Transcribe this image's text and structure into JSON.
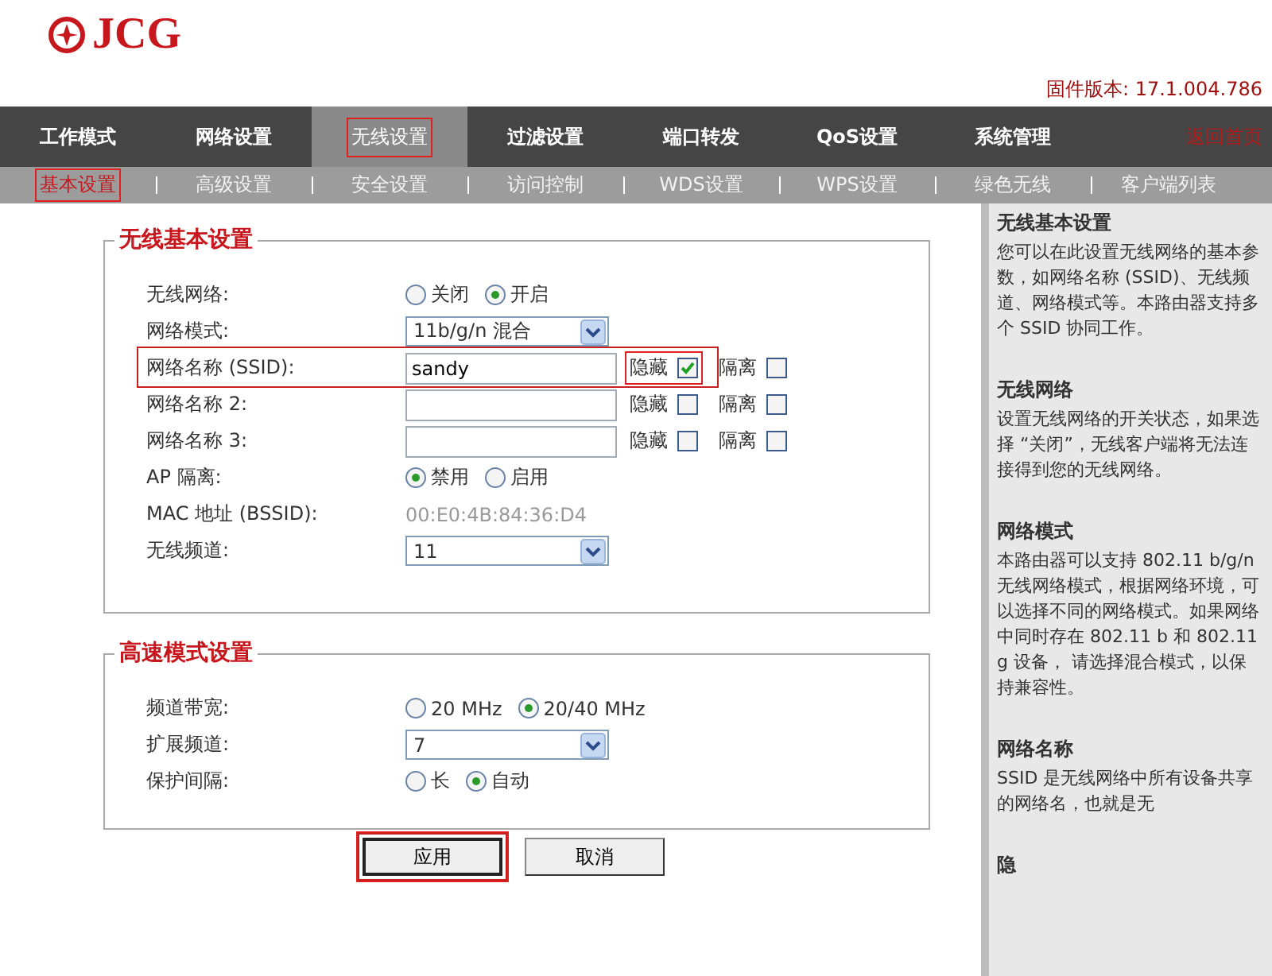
{
  "logo": {
    "text": "JCG"
  },
  "firmware": "固件版本: 17.1.004.786",
  "nav": [
    {
      "label": "工作模式",
      "selected": false,
      "highlighted": false
    },
    {
      "label": "网络设置",
      "selected": false,
      "highlighted": false
    },
    {
      "label": "无线设置",
      "selected": true,
      "highlighted": true
    },
    {
      "label": "过滤设置",
      "selected": false,
      "highlighted": false
    },
    {
      "label": "端口转发",
      "selected": false,
      "highlighted": false
    },
    {
      "label": "QoS设置",
      "selected": false,
      "highlighted": false
    },
    {
      "label": "系统管理",
      "selected": false,
      "highlighted": false
    }
  ],
  "home_link": "返回首页",
  "subnav": [
    {
      "label": "基本设置",
      "selected": true,
      "highlighted": true
    },
    {
      "label": "高级设置",
      "selected": false,
      "highlighted": false
    },
    {
      "label": "安全设置",
      "selected": false,
      "highlighted": false
    },
    {
      "label": "访问控制",
      "selected": false,
      "highlighted": false
    },
    {
      "label": "WDS设置",
      "selected": false,
      "highlighted": false
    },
    {
      "label": "WPS设置",
      "selected": false,
      "highlighted": false
    },
    {
      "label": "绿色无线",
      "selected": false,
      "highlighted": false
    },
    {
      "label": "客户端列表",
      "selected": false,
      "highlighted": false
    }
  ],
  "sections": [
    {
      "title": "无线基本设置",
      "rows": [
        {
          "kind": "radio",
          "label": "无线网络:",
          "options": [
            {
              "label": "关闭",
              "selected": false
            },
            {
              "label": "开启",
              "selected": true
            }
          ]
        },
        {
          "kind": "select",
          "label": "网络模式:",
          "value": "11b/g/n 混合"
        },
        {
          "kind": "ssid",
          "label": "网络名称 (SSID):",
          "value": "sandy",
          "highlighted": true,
          "checks": [
            {
              "label": "隐藏",
              "checked": true,
              "highlighted": true
            },
            {
              "label": "隔离",
              "checked": false,
              "highlighted": false
            }
          ]
        },
        {
          "kind": "ssid",
          "label": "网络名称 2:",
          "highlighted": false,
          "checks": [
            {
              "label": "隐藏",
              "checked": false,
              "highlighted": false
            },
            {
              "label": "隔离",
              "checked": false,
              "highlighted": false
            }
          ]
        },
        {
          "kind": "ssid",
          "label": "网络名称 3:",
          "highlighted": false,
          "checks": [
            {
              "label": "隐藏",
              "checked": false,
              "highlighted": false
            },
            {
              "label": "隔离",
              "checked": false,
              "highlighted": false
            }
          ]
        },
        {
          "kind": "radio",
          "label": "AP 隔离:",
          "options": [
            {
              "label": "禁用",
              "selected": true
            },
            {
              "label": "启用",
              "selected": false
            }
          ]
        },
        {
          "kind": "text",
          "label": "MAC 地址 (BSSID):",
          "value": "00:E0:4B:84:36:D4"
        },
        {
          "kind": "select",
          "label": "无线频道:",
          "value": "11"
        }
      ]
    },
    {
      "title": "高速模式设置",
      "rows": [
        {
          "kind": "radio",
          "label": "频道带宽:",
          "options": [
            {
              "label": "20 MHz",
              "selected": false
            },
            {
              "label": "20/40 MHz",
              "selected": true
            }
          ]
        },
        {
          "kind": "select",
          "label": "扩展频道:",
          "value": "7"
        },
        {
          "kind": "radio",
          "label": "保护间隔:",
          "options": [
            {
              "label": "长",
              "selected": false
            },
            {
              "label": "自动",
              "selected": true
            }
          ]
        }
      ]
    }
  ],
  "buttons": [
    {
      "label": "应用",
      "highlighted": true
    },
    {
      "label": "取消",
      "highlighted": false
    }
  ],
  "help": [
    {
      "title": "无线基本设置",
      "text": "您可以在此设置无线网络的基本参数，如网络名称 (SSID)、无线频道、网络模式等。本路由器支持多个 SSID 协同工作。"
    },
    {
      "title": "无线网络",
      "text": "设置无线网络的开关状态，如果选择 “关闭”，无线客户端将无法连接得到您的无线网络。"
    },
    {
      "title": "网络模式",
      "text": "本路由器可以支持 802.11 b/g/n 无线网络模式，根据网络环境，可以选择不同的网络模式。如果网络中同时存在 802.11 b 和 802.11 g 设备， 请选择混合模式，以保持兼容性。"
    },
    {
      "title": "网络名称",
      "text": "SSID 是无线网络中所有设备共享的网络名，也就是无"
    },
    {
      "title": "隐"
    }
  ]
}
